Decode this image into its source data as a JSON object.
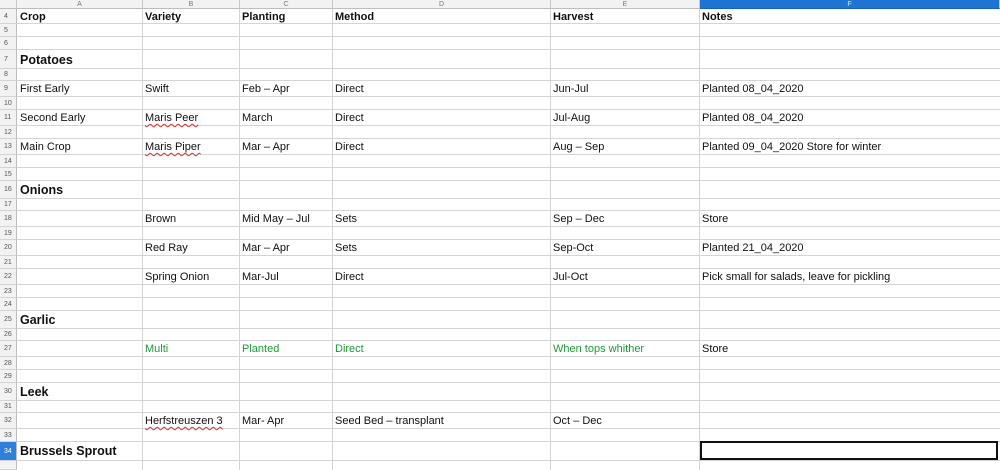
{
  "columns": [
    "A",
    "B",
    "C",
    "D",
    "E",
    "F"
  ],
  "selected_column": "F",
  "selected_row": "34",
  "row_numbers": [
    "4",
    "5",
    "6",
    "7",
    "8",
    "9",
    "10",
    "11",
    "12",
    "13",
    "14",
    "15",
    "16",
    "17",
    "18",
    "19",
    "20",
    "21",
    "22",
    "23",
    "24",
    "25",
    "26",
    "27",
    "28",
    "29",
    "30",
    "31",
    "32",
    "33",
    "34"
  ],
  "headers": {
    "crop": "Crop",
    "variety": "Variety",
    "planting": "Planting",
    "method": "Method",
    "harvest": "Harvest",
    "notes": "Notes"
  },
  "sections": {
    "potatoes": "Potatoes",
    "onions": "Onions",
    "garlic": "Garlic",
    "leek": "Leek",
    "brussels": "Brussels Sprout"
  },
  "rows": {
    "first_early": {
      "crop": "First Early",
      "variety": "Swift",
      "planting": "Feb – Apr",
      "method": "Direct",
      "harvest": "Jun-Jul",
      "notes": "Planted 08_04_2020"
    },
    "second_early": {
      "crop": "Second Early",
      "variety": "Maris Peer",
      "planting": "March",
      "method": "Direct",
      "harvest": "Jul-Aug",
      "notes": "Planted 08_04_2020"
    },
    "main_crop": {
      "crop": "Main Crop",
      "variety": "Maris Piper",
      "planting": "Mar – Apr",
      "method": "Direct",
      "harvest": "Aug – Sep",
      "notes": "Planted 09_04_2020 Store for winter"
    },
    "brown": {
      "variety": "Brown",
      "planting": "Mid May – Jul",
      "method": "Sets",
      "harvest": "Sep – Dec",
      "notes": "Store"
    },
    "red_ray": {
      "variety": "Red Ray",
      "planting": "Mar – Apr",
      "method": "Sets",
      "harvest": "Sep-Oct",
      "notes": "Planted 21_04_2020"
    },
    "spring_onion": {
      "variety": "Spring Onion",
      "planting": "Mar-Jul",
      "method": "Direct",
      "harvest": "Jul-Oct",
      "notes": "Pick small for salads, leave for pickling"
    },
    "multi": {
      "variety": "Multi",
      "planting": "Planted",
      "method": "Direct",
      "harvest": "When tops whither",
      "notes": "Store"
    },
    "herfst": {
      "variety": "Herfstreuszen 3",
      "planting": "Mar- Apr",
      "method": "Seed Bed – transplant",
      "harvest": "Oct – Dec"
    }
  },
  "colors": {
    "selection_header": "#1e74d3",
    "highlight_text": "#1e9a38",
    "grid_line": "#d4d4d4"
  }
}
